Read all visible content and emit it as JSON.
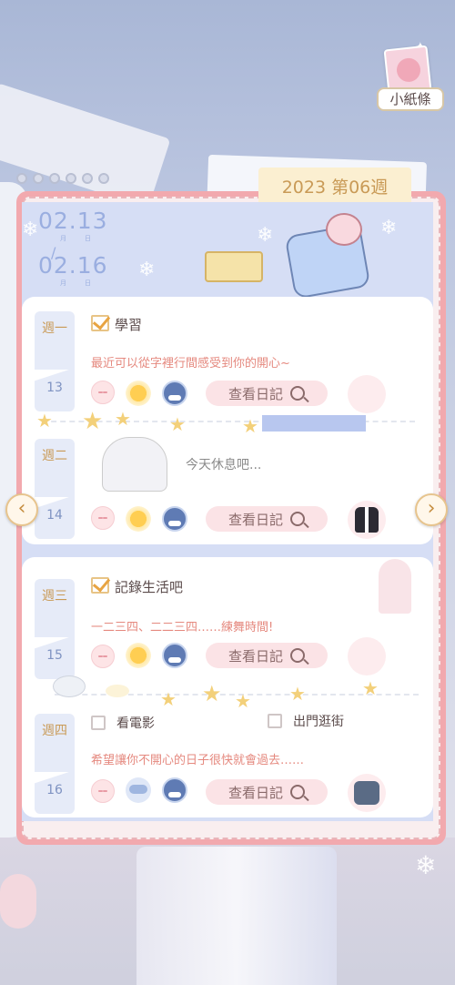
{
  "note": {
    "label": "小紙條"
  },
  "week_tab": "2023 第06週",
  "dates": {
    "start": "02.13",
    "end": "02.16",
    "month_label": "月",
    "day_label": "日",
    "slash": "/"
  },
  "days": [
    {
      "weekday": "週一",
      "day": "13",
      "task": "學習",
      "task_checked": true,
      "entry": "最近可以從字裡行間感受到你的開心~",
      "button": "查看日記"
    },
    {
      "weekday": "週二",
      "day": "14",
      "rest_text": "今天休息吧...",
      "button": "查看日記"
    },
    {
      "weekday": "週三",
      "day": "15",
      "task": "記錄生活吧",
      "task_checked": true,
      "entry": "一二三四、二二三四……練舞時間!",
      "button": "查看日記"
    },
    {
      "weekday": "週四",
      "day": "16",
      "task_a": "看電影",
      "task_b": "出門逛街",
      "entry": "希望讓你不開心的日子很快就會過去……",
      "button": "查看日記"
    }
  ],
  "nav": {
    "prev": "‹",
    "next": "›"
  },
  "colors": {
    "accent_pink": "#f2a9ae",
    "entry_text": "#e5897f",
    "tab_gold": "#c99a56",
    "date_blue": "#9aaee0"
  }
}
